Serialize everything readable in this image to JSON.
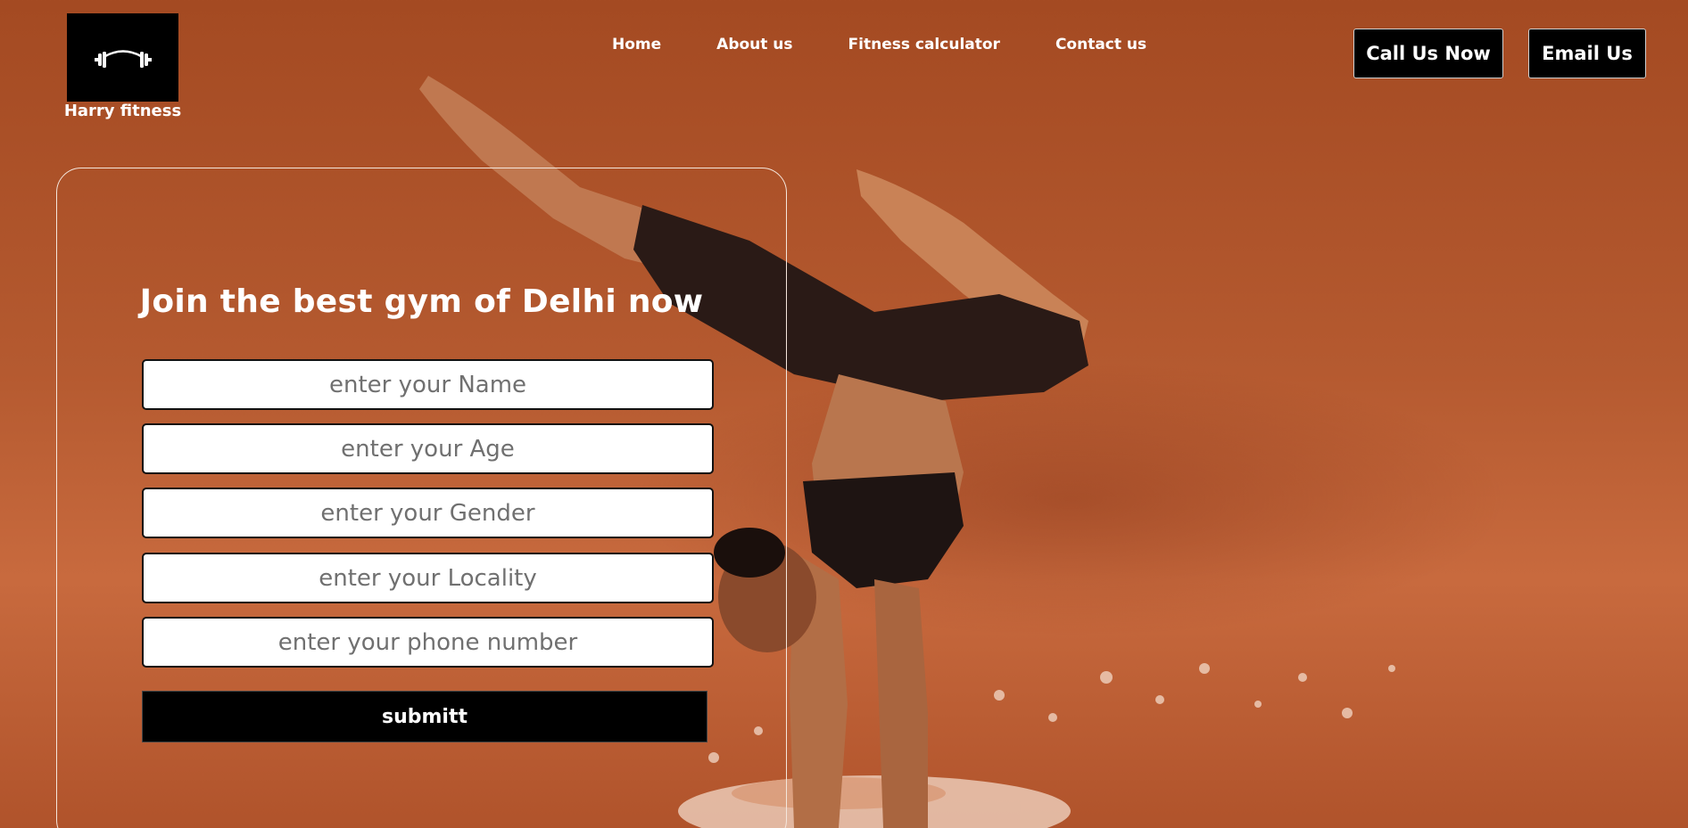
{
  "brand": {
    "name": "Harry fitness",
    "logo_icon": "dumbbell-icon"
  },
  "nav": {
    "items": [
      "Home",
      "About us",
      "Fitness calculator",
      "Contact us"
    ]
  },
  "header_buttons": {
    "call": "Call Us Now",
    "email": "Email Us"
  },
  "form": {
    "title": "Join the best gym of Delhi now",
    "fields": [
      {
        "placeholder": "enter your Name"
      },
      {
        "placeholder": "enter your Age"
      },
      {
        "placeholder": "enter your Gender"
      },
      {
        "placeholder": "enter your Locality"
      },
      {
        "placeholder": "enter your phone number"
      }
    ],
    "submit_label": "submitt"
  },
  "colors": {
    "background": "#b55a30",
    "button": "#000000",
    "text": "#ffffff"
  }
}
